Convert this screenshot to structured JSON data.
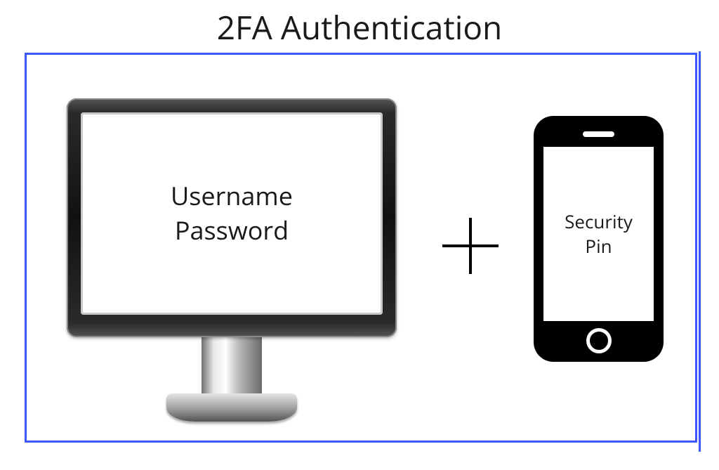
{
  "title": "2FA Authentication",
  "monitor": {
    "line1": "Username",
    "line2": "Password"
  },
  "plus_symbol": "+",
  "phone": {
    "line1": "Security",
    "line2": "Pin"
  }
}
